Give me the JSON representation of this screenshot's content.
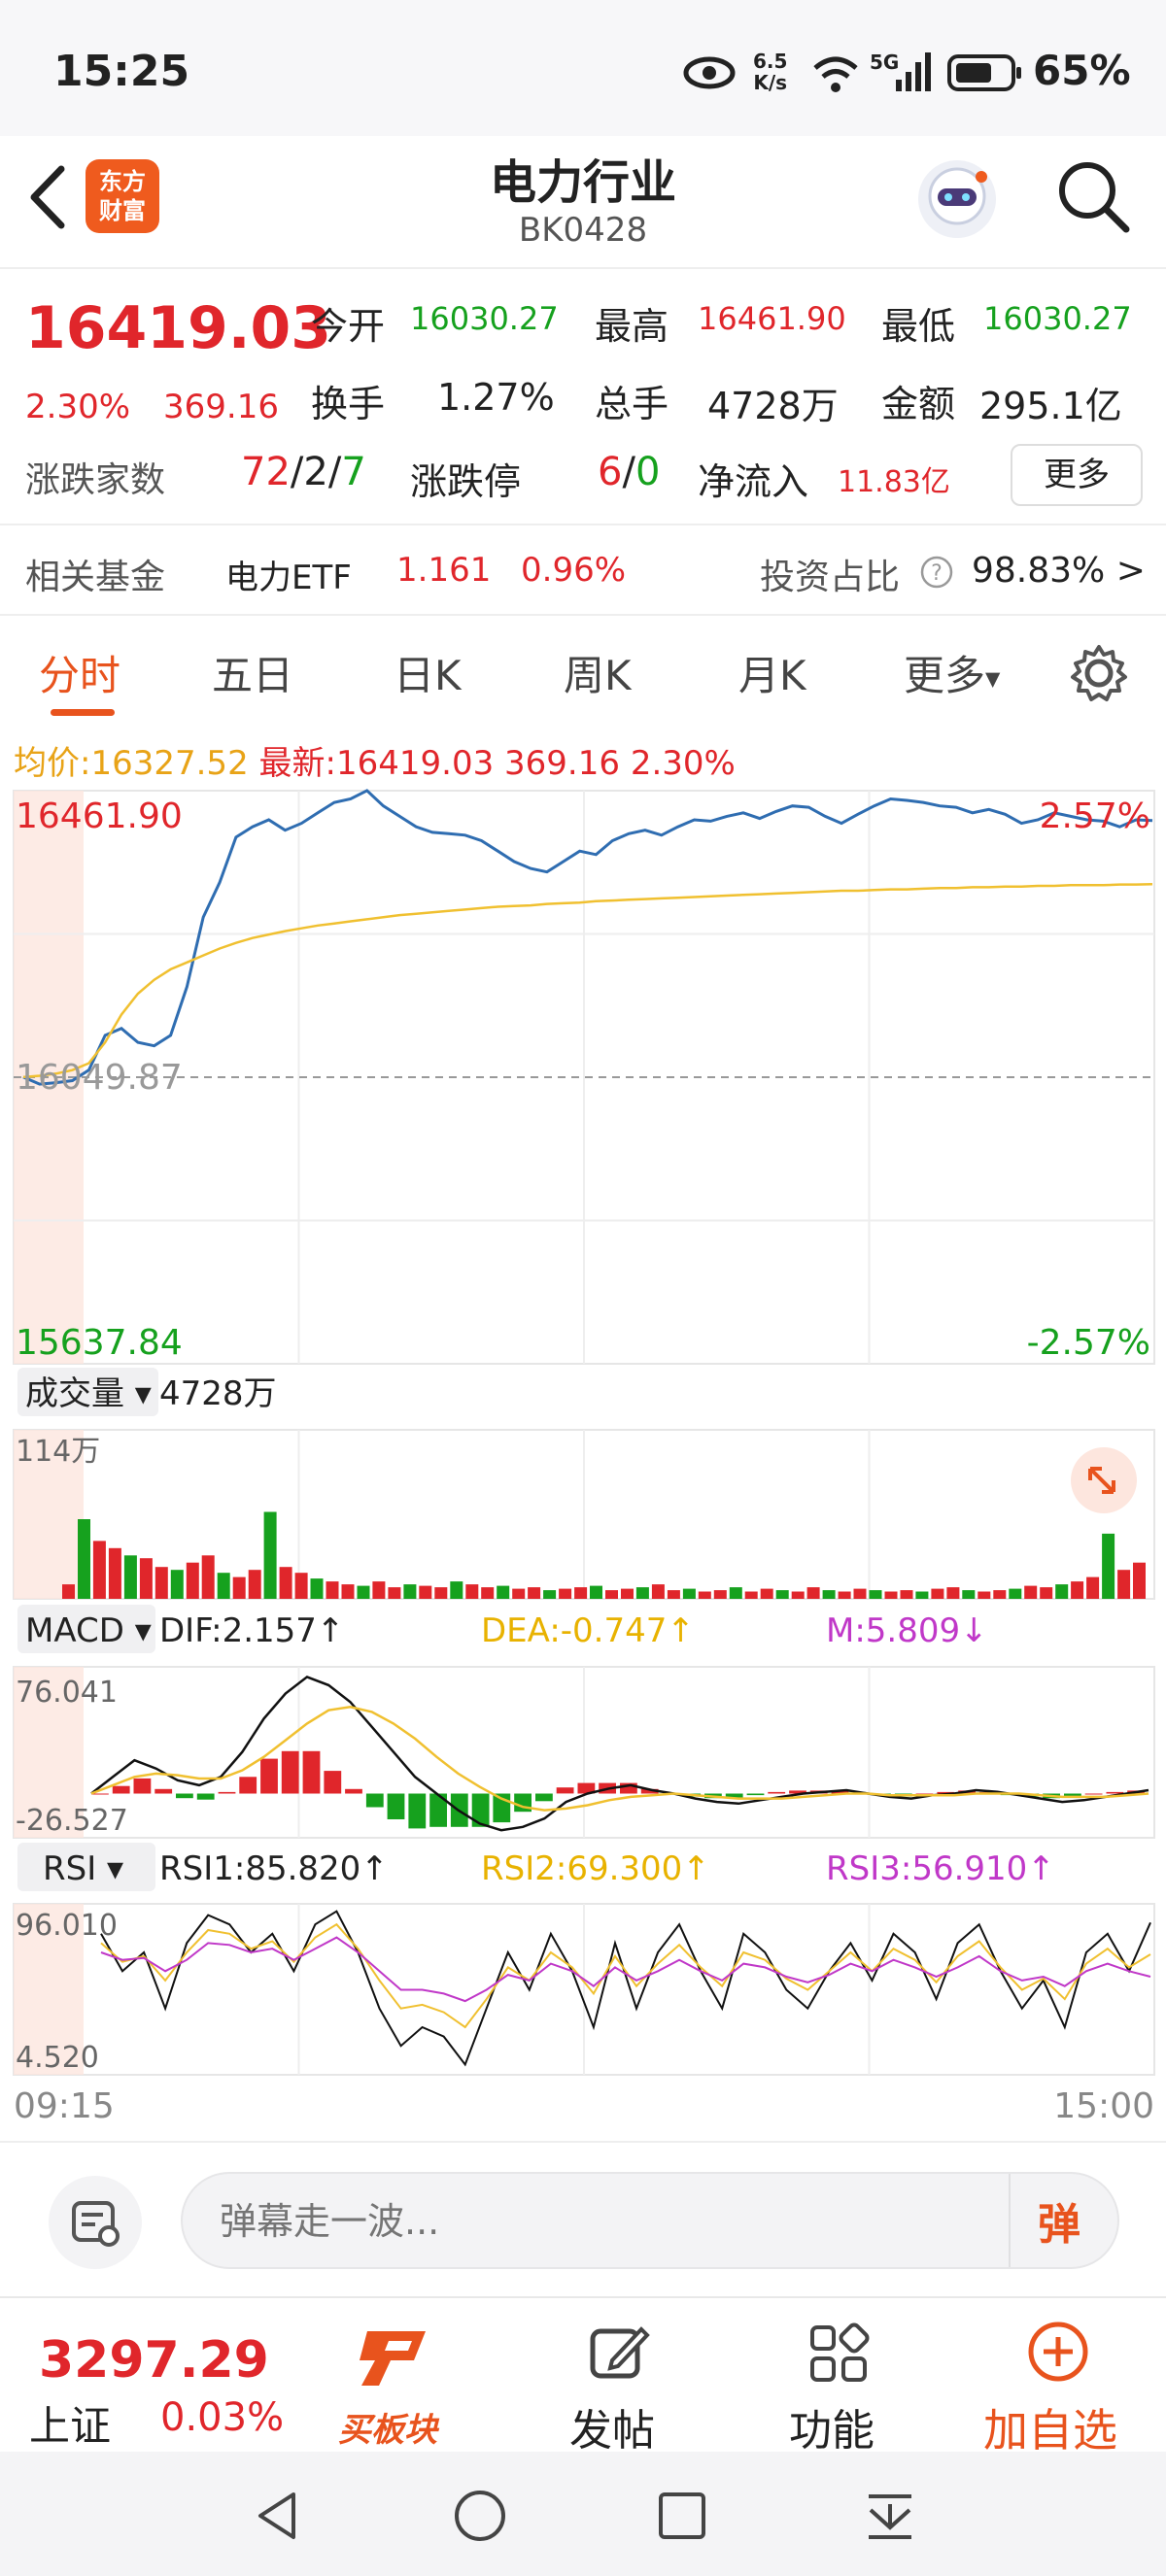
{
  "status": {
    "time": "15:25",
    "net_speed_top": "6.5",
    "net_speed_bottom": "K/s",
    "network": "5G",
    "battery": "65%"
  },
  "header": {
    "title": "电力行业",
    "code": "BK0428",
    "logo_top": "东方",
    "logo_bottom": "财富"
  },
  "quote": {
    "price": "16419.03",
    "change_pct": "2.30%",
    "change": "369.16",
    "open_label": "今开",
    "open": "16030.27",
    "high_label": "最高",
    "high": "16461.90",
    "low_label": "最低",
    "low": "16030.27",
    "turnover_label": "换手",
    "turnover": "1.27%",
    "volume_label": "总手",
    "volume": "4728万",
    "amount_label": "金额",
    "amount": "295.1亿",
    "advdec_label": "涨跌家数",
    "adv": "72",
    "sep1": "/",
    "flat": "2",
    "sep2": "/",
    "dec": "7",
    "limit_label": "涨跌停",
    "limit_up": "6",
    "sep3": "/",
    "limit_down": "0",
    "inflow_label": "净流入",
    "inflow": "11.83亿",
    "more_label": "更多"
  },
  "fund": {
    "label": "相关基金",
    "name": "电力ETF",
    "price": "1.161",
    "pct": "0.96%",
    "ratio_label": "投资占比",
    "ratio": "98.83%",
    "arrow": ">"
  },
  "tabs": [
    {
      "label": "分时",
      "active": true
    },
    {
      "label": "五日",
      "active": false
    },
    {
      "label": "日K",
      "active": false
    },
    {
      "label": "周K",
      "active": false
    },
    {
      "label": "月K",
      "active": false
    },
    {
      "label": "更多",
      "active": false
    }
  ],
  "info": {
    "avg_label": "均价:",
    "avg": "16327.52",
    "latest_label": "最新:",
    "latest": "16419.03",
    "change": "369.16",
    "pct": "2.30%"
  },
  "chart_data": [
    {
      "type": "line",
      "title": "分时",
      "y_top": "16461.90",
      "y_mid": "16049.87",
      "y_bottom": "15637.84",
      "pct_top": "2.57%",
      "pct_bottom": "-2.57%",
      "ylim": [
        15637.84,
        16461.9
      ],
      "x_start": "09:15",
      "x_end": "15:00",
      "series": [
        {
          "name": "price",
          "color": "#2f6db1",
          "values": [
            16050,
            16040,
            16042,
            16045,
            16060,
            16110,
            16120,
            16100,
            16095,
            16110,
            16180,
            16280,
            16330,
            16395,
            16410,
            16420,
            16405,
            16415,
            16430,
            16445,
            16450,
            16462,
            16440,
            16425,
            16410,
            16402,
            16400,
            16398,
            16390,
            16375,
            16360,
            16350,
            16345,
            16360,
            16375,
            16370,
            16390,
            16400,
            16405,
            16398,
            16410,
            16420,
            16418,
            16425,
            16430,
            16422,
            16432,
            16440,
            16438,
            16425,
            16415,
            16428,
            16440,
            16450,
            16448,
            16445,
            16440,
            16438,
            16430,
            16435,
            16428,
            16415,
            16420,
            16430,
            16425,
            16420,
            16418,
            16410,
            16420,
            16419
          ]
        },
        {
          "name": "avg",
          "color": "#f0c030",
          "values": [
            16050,
            16052,
            16055,
            16060,
            16070,
            16100,
            16140,
            16170,
            16190,
            16205,
            16215,
            16225,
            16235,
            16243,
            16250,
            16255,
            16260,
            16264,
            16268,
            16271,
            16274,
            16277,
            16280,
            16283,
            16285,
            16287,
            16289,
            16291,
            16293,
            16295,
            16296,
            16297,
            16299,
            16300,
            16301,
            16303,
            16304,
            16305,
            16306,
            16307,
            16308,
            16309,
            16310,
            16311,
            16312,
            16313,
            16314,
            16315,
            16316,
            16317,
            16318,
            16318,
            16319,
            16320,
            16320,
            16321,
            16322,
            16322,
            16323,
            16323,
            16324,
            16324,
            16325,
            16325,
            16326,
            16326,
            16326,
            16327,
            16327,
            16327.52
          ]
        }
      ]
    },
    {
      "type": "bar",
      "title": "成交量",
      "label": "成交量",
      "total": "4728万",
      "max_label": "114万",
      "ylim": [
        0,
        114
      ],
      "values": [
        10,
        55,
        40,
        35,
        30,
        28,
        22,
        20,
        25,
        30,
        18,
        15,
        20,
        60,
        22,
        18,
        14,
        12,
        10,
        9,
        12,
        8,
        10,
        9,
        8,
        12,
        10,
        8,
        9,
        7,
        8,
        6,
        7,
        8,
        9,
        6,
        7,
        8,
        10,
        6,
        7,
        5,
        6,
        8,
        5,
        7,
        6,
        5,
        8,
        6,
        5,
        7,
        6,
        5,
        6,
        5,
        7,
        8,
        6,
        5,
        6,
        7,
        9,
        8,
        10,
        12,
        15,
        45,
        20,
        25
      ]
    },
    {
      "type": "bar",
      "title": "MACD",
      "label": "MACD",
      "dif": "DIF:2.157↑",
      "dea": "DEA:-0.747↑",
      "m": "M:5.809↓",
      "y_top": "76.041",
      "y_bottom": "-26.527",
      "ylim": [
        -26.527,
        76.041
      ],
      "dif_values": [
        0,
        10,
        20,
        15,
        8,
        5,
        10,
        25,
        45,
        60,
        70,
        65,
        55,
        40,
        25,
        10,
        0,
        -10,
        -18,
        -22,
        -20,
        -15,
        -5,
        0,
        3,
        5,
        2,
        0,
        -3,
        -5,
        -6,
        -4,
        -2,
        0,
        1,
        2,
        0,
        -2,
        -3,
        -1,
        0,
        2,
        1,
        -1,
        -3,
        -5,
        -4,
        -2,
        0,
        2
      ],
      "dea_values": [
        0,
        5,
        10,
        12,
        11,
        9,
        9,
        14,
        22,
        32,
        42,
        50,
        52,
        49,
        42,
        33,
        22,
        12,
        4,
        -3,
        -8,
        -10,
        -9,
        -7,
        -4,
        -2,
        -1,
        0,
        -1,
        -2,
        -3,
        -3,
        -3,
        -2,
        -1,
        0,
        0,
        -1,
        -1,
        -1,
        -1,
        0,
        0,
        0,
        -1,
        -2,
        -2,
        -2,
        -1,
        0
      ],
      "hist_values": [
        0,
        10,
        20,
        6,
        -6,
        -8,
        2,
        22,
        46,
        56,
        56,
        30,
        6,
        -18,
        -34,
        -46,
        -44,
        -44,
        -44,
        -38,
        -24,
        -10,
        8,
        14,
        14,
        14,
        6,
        0,
        -4,
        -6,
        -6,
        -2,
        2,
        4,
        4,
        4,
        0,
        -2,
        -4,
        0,
        2,
        4,
        2,
        -2,
        -4,
        -6,
        -4,
        0,
        2,
        4
      ]
    },
    {
      "type": "line",
      "title": "RSI",
      "label": "RSI",
      "rsi1": "RSI1:85.820↑",
      "rsi2": "RSI2:69.300↑",
      "rsi3": "RSI3:56.910↑",
      "y_top": "96.010",
      "y_bottom": "4.520",
      "ylim": [
        4.52,
        96.01
      ],
      "series": [
        {
          "name": "RSI1",
          "color": "#111111",
          "values": [
            80,
            60,
            70,
            40,
            75,
            90,
            85,
            70,
            80,
            60,
            85,
            92,
            70,
            40,
            20,
            30,
            25,
            10,
            40,
            70,
            50,
            80,
            60,
            30,
            75,
            40,
            70,
            85,
            60,
            40,
            80,
            70,
            50,
            40,
            60,
            75,
            55,
            80,
            70,
            45,
            75,
            85,
            60,
            40,
            55,
            30,
            70,
            80,
            60,
            86
          ]
        },
        {
          "name": "RSI2",
          "color": "#f0c030",
          "values": [
            75,
            65,
            68,
            55,
            70,
            82,
            80,
            72,
            76,
            65,
            78,
            85,
            72,
            55,
            40,
            42,
            38,
            30,
            45,
            62,
            55,
            70,
            62,
            48,
            68,
            52,
            64,
            74,
            62,
            52,
            70,
            66,
            56,
            50,
            60,
            70,
            60,
            72,
            66,
            54,
            68,
            76,
            62,
            50,
            56,
            45,
            64,
            72,
            62,
            69
          ]
        },
        {
          "name": "RSI3",
          "color": "#c038c8",
          "values": [
            70,
            66,
            67,
            60,
            66,
            75,
            74,
            70,
            72,
            66,
            72,
            78,
            70,
            60,
            50,
            50,
            48,
            44,
            50,
            58,
            55,
            64,
            60,
            52,
            62,
            55,
            60,
            66,
            60,
            55,
            64,
            62,
            57,
            54,
            58,
            64,
            60,
            66,
            62,
            57,
            62,
            68,
            60,
            55,
            57,
            52,
            60,
            64,
            60,
            57
          ]
        }
      ]
    }
  ],
  "comment": {
    "placeholder": "弹幕走一波...",
    "danmu_label": "弹"
  },
  "bottom": {
    "index_value": "3297.29",
    "index_name": "上证",
    "index_pct": "0.03%",
    "board_label": "买板块",
    "post_label": "发帖",
    "func_label": "功能",
    "add_label": "加自选"
  },
  "colors": {
    "up": "#e0262b",
    "down": "#16a11e",
    "accent": "#e8531d",
    "price_line": "#2f6db1",
    "avg_line": "#f0c030"
  }
}
